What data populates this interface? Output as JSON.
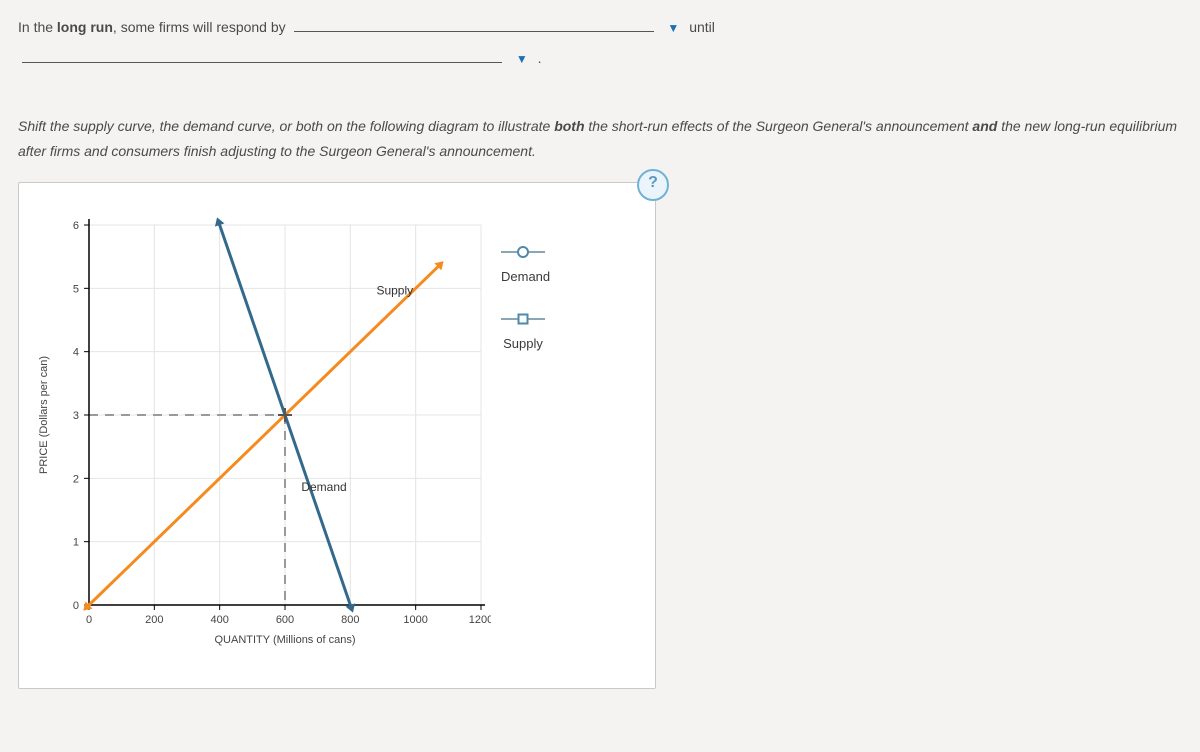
{
  "question": {
    "prefix": "In the ",
    "bold1": "long run",
    "mid": ", some firms will respond by ",
    "after": "until",
    "period": "."
  },
  "instruction": {
    "p1": "Shift the supply curve, the demand curve, or both on the following diagram to illustrate ",
    "b1": "both",
    "p2": " the short-run effects of the Surgeon General's announcement ",
    "b2": "and",
    "p3": " the new long-run equilibrium after firms and consumers finish adjusting to the Surgeon General's announcement."
  },
  "help": "?",
  "legend": {
    "demand": "Demand",
    "supply": "Supply"
  },
  "chart_data": {
    "type": "line",
    "xlabel": "QUANTITY (Millions of cans)",
    "ylabel": "PRICE (Dollars per can)",
    "x_ticks": [
      0,
      200,
      400,
      600,
      800,
      1000,
      1200
    ],
    "y_ticks": [
      0,
      1,
      2,
      3,
      4,
      5,
      6
    ],
    "xlim": [
      0,
      1200
    ],
    "ylim": [
      0,
      6
    ],
    "grid": true,
    "series": [
      {
        "name": "Supply",
        "color": "#f58b1f",
        "points": [
          [
            0,
            0
          ],
          [
            1068,
            5.34
          ]
        ]
      },
      {
        "name": "Demand",
        "color": "#336a8c",
        "points": [
          [
            400,
            6
          ],
          [
            800,
            0
          ]
        ]
      }
    ],
    "equilibrium": {
      "x": 600,
      "y": 3
    },
    "curve_labels": {
      "supply": "Supply",
      "demand": "Demand"
    }
  }
}
